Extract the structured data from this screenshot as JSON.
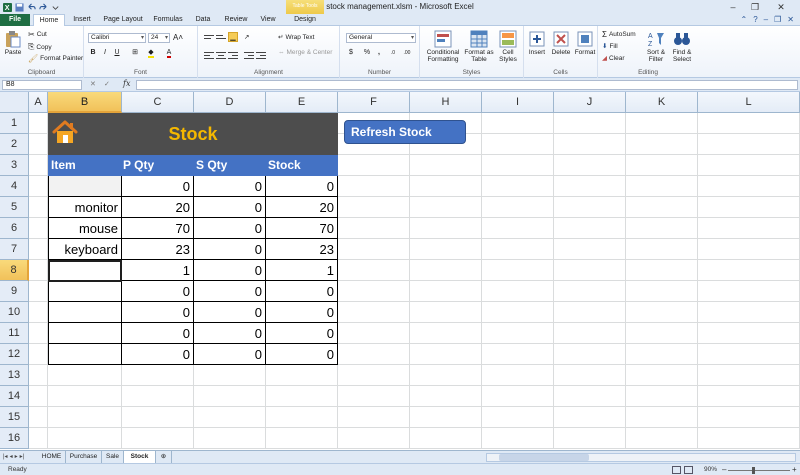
{
  "window": {
    "title": "stock management.xlsm - Microsoft Excel",
    "contextual_tab_group": "Table Tools"
  },
  "ribbon_tabs": [
    "File",
    "Home",
    "Insert",
    "Page Layout",
    "Formulas",
    "Data",
    "Review",
    "View",
    "Design"
  ],
  "ribbon": {
    "clipboard": {
      "label": "Clipboard",
      "paste": "Paste",
      "cut": "Cut",
      "copy": "Copy",
      "format_painter": "Format Painter"
    },
    "font": {
      "label": "Font",
      "font_name": "Calibri",
      "font_size": "24",
      "bold": "B",
      "italic": "I",
      "underline": "U"
    },
    "alignment": {
      "label": "Alignment",
      "wrap_text": "Wrap Text",
      "merge_center": "Merge & Center"
    },
    "number": {
      "label": "Number",
      "format": "General",
      "currency": "$",
      "percent": "%",
      "comma": ",",
      "inc_decimal": ".0",
      "dec_decimal": ".00"
    },
    "styles": {
      "label": "Styles",
      "conditional": "Conditional Formatting",
      "format_table": "Format as Table",
      "cell_styles": "Cell Styles"
    },
    "cells": {
      "label": "Cells",
      "insert": "Insert",
      "delete": "Delete",
      "format": "Format"
    },
    "editing": {
      "label": "Editing",
      "autosum": "AutoSum",
      "fill": "Fill",
      "clear": "Clear",
      "sort_filter": "Sort & Filter",
      "find_select": "Find & Select"
    }
  },
  "formula_bar": {
    "name_box": "B8",
    "fx": "fx",
    "formula": ""
  },
  "columns": [
    "A",
    "B",
    "C",
    "D",
    "E",
    "F",
    "H",
    "I",
    "J",
    "K",
    "L"
  ],
  "rows": [
    "1",
    "2",
    "3",
    "4",
    "5",
    "6",
    "7",
    "8",
    "9",
    "10",
    "11",
    "12",
    "13",
    "14",
    "15",
    "16"
  ],
  "selected_cell": {
    "column": "B",
    "row": "8"
  },
  "sheet": {
    "title": "Stock",
    "headers": [
      "Item",
      "P Qty",
      "S Qty",
      "Stock"
    ],
    "table_rows": [
      {
        "item": "",
        "p_qty": "0",
        "s_qty": "0",
        "stock": "0"
      },
      {
        "item": "monitor",
        "p_qty": "20",
        "s_qty": "0",
        "stock": "20"
      },
      {
        "item": "mouse",
        "p_qty": "70",
        "s_qty": "0",
        "stock": "70"
      },
      {
        "item": "keyboard",
        "p_qty": "23",
        "s_qty": "0",
        "stock": "23"
      },
      {
        "item": "",
        "p_qty": "1",
        "s_qty": "0",
        "stock": "1"
      },
      {
        "item": "",
        "p_qty": "0",
        "s_qty": "0",
        "stock": "0"
      },
      {
        "item": "",
        "p_qty": "0",
        "s_qty": "0",
        "stock": "0"
      },
      {
        "item": "",
        "p_qty": "0",
        "s_qty": "0",
        "stock": "0"
      },
      {
        "item": "",
        "p_qty": "0",
        "s_qty": "0",
        "stock": "0"
      }
    ],
    "refresh_button": "Refresh Stock"
  },
  "sheet_tabs": [
    "HOME",
    "Purchase",
    "Sale",
    "Stock"
  ],
  "active_sheet": "Stock",
  "status": {
    "text": "Ready",
    "zoom": "90%"
  },
  "colors": {
    "accent_blue": "#4472c4",
    "title_bg": "#4d4d4d",
    "title_text": "#f5b800",
    "file_tab": "#1f6e43"
  }
}
